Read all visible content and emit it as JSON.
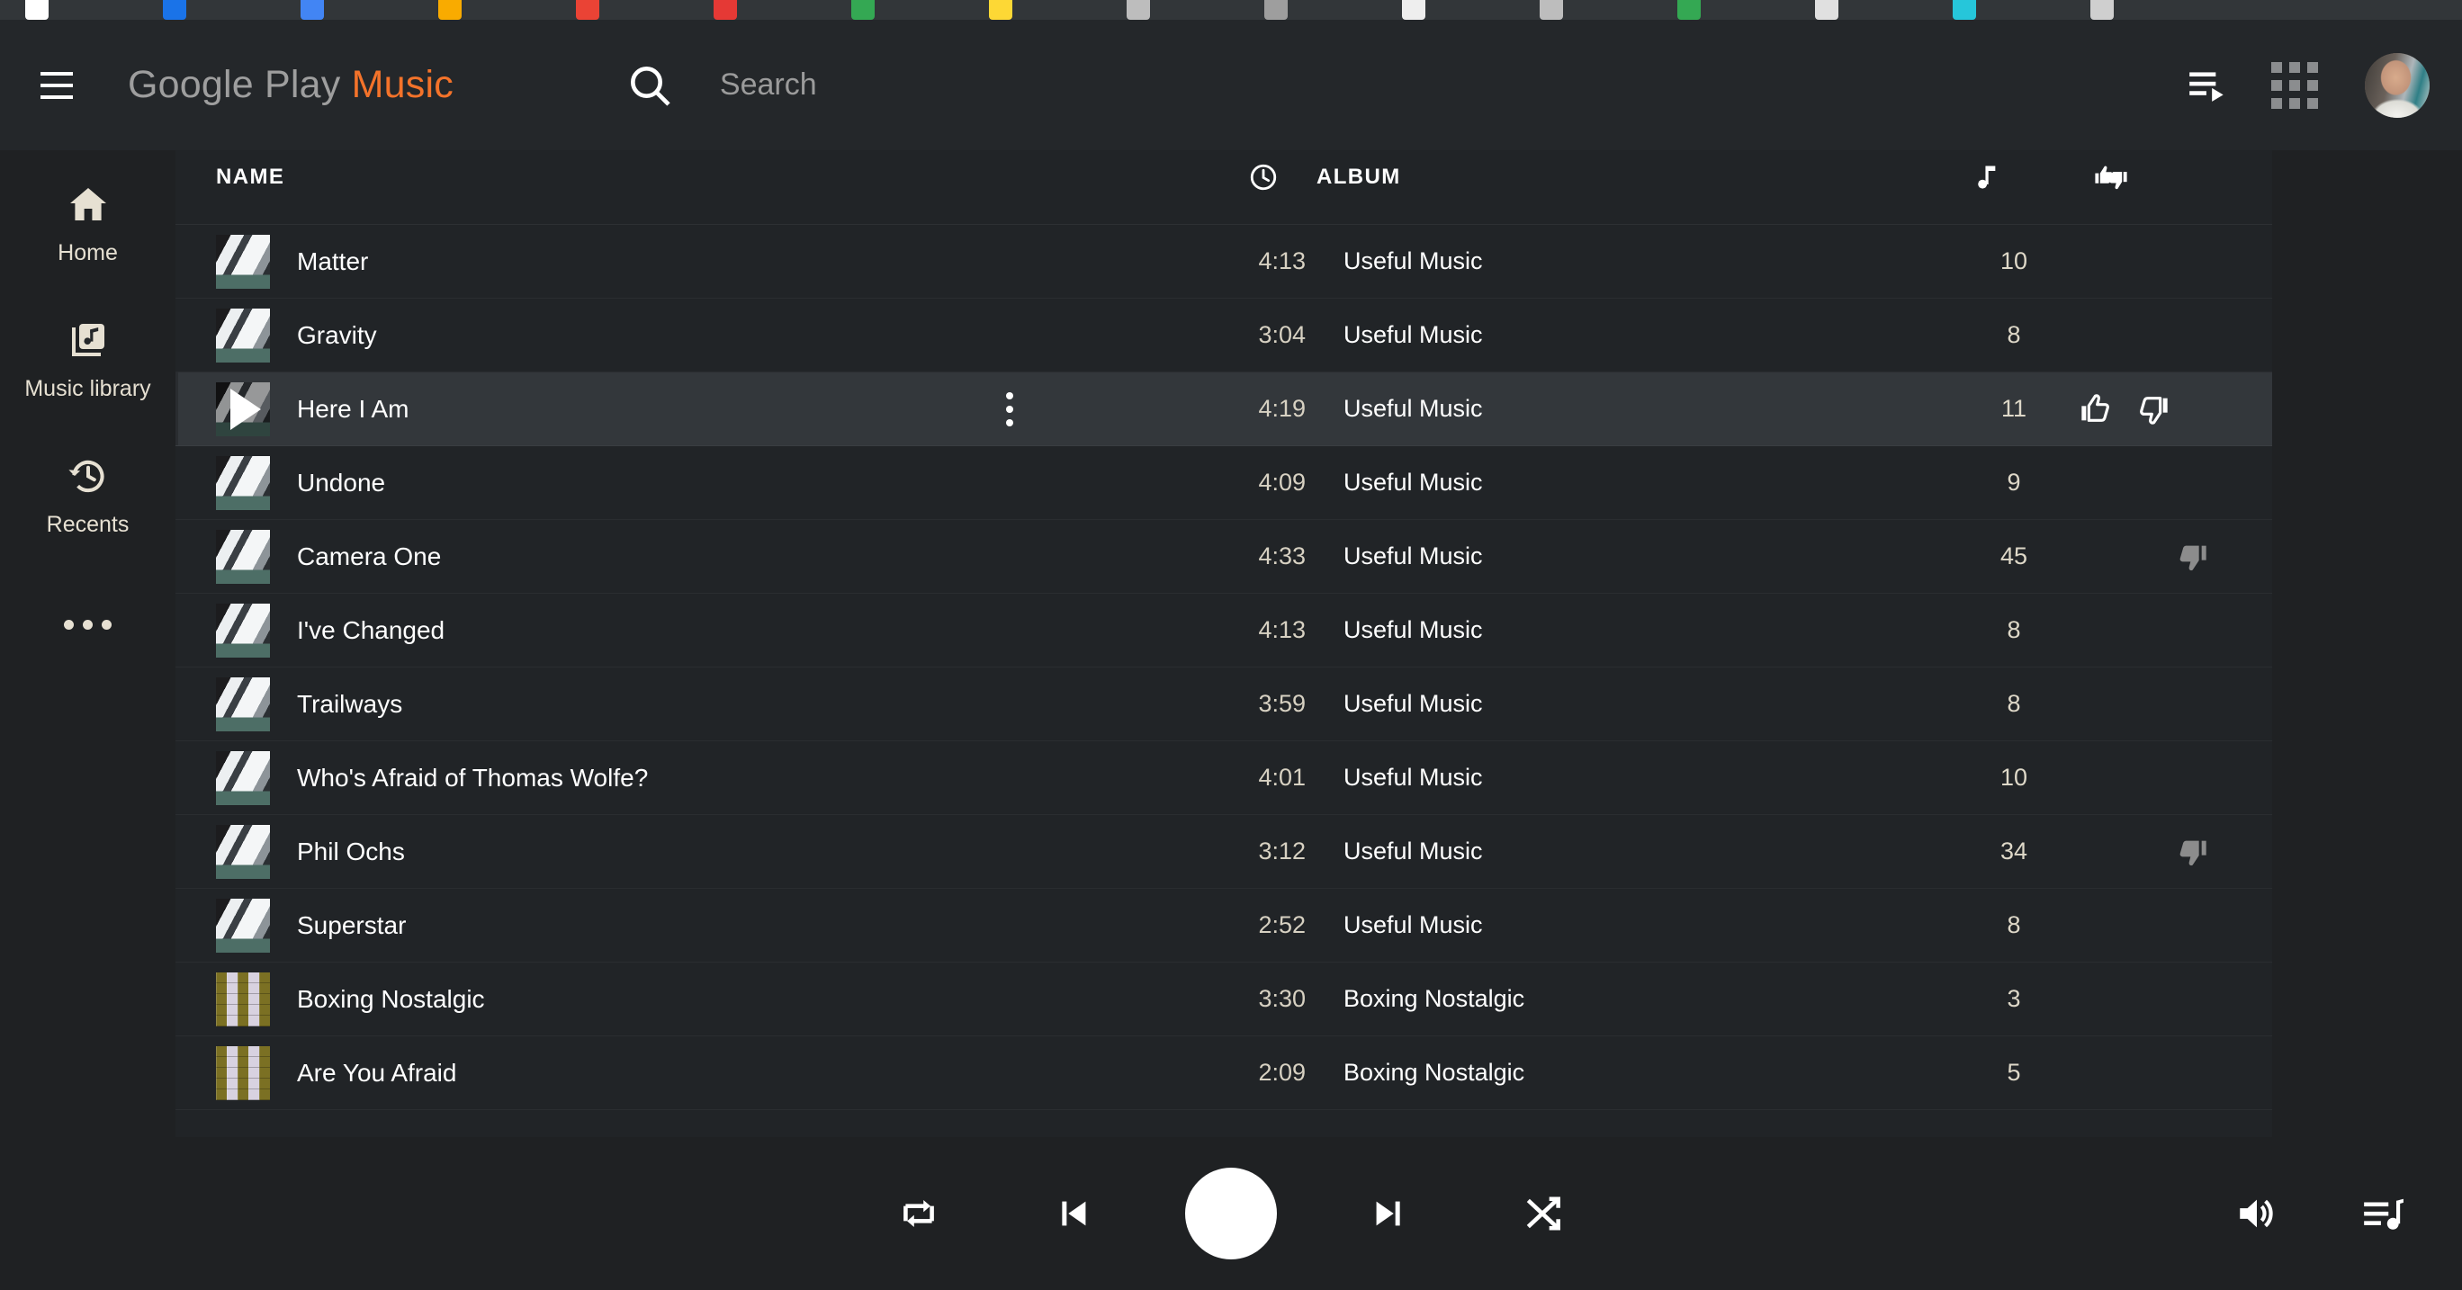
{
  "browser": {
    "favicon_colors": [
      "#ffffff",
      "#1a73e8",
      "#4285f4",
      "#f9ab00",
      "#ea4335",
      "#e53935",
      "#34a853",
      "#fdd835",
      "#bdbdbd",
      "#9e9e9e",
      "#eeeeee",
      "#bdbdbd",
      "#34a853",
      "#e0e0e0",
      "#26c6da",
      "#cfcfcf"
    ]
  },
  "header": {
    "menu_icon": "hamburger-menu-icon",
    "brand_part1": "Google Play",
    "brand_part2": "Music",
    "brand_accent_color": "#f4732a",
    "search": {
      "icon": "search-icon",
      "placeholder": "Search",
      "value": ""
    },
    "queue_icon": "playlist-play-icon",
    "apps_icon": "apps-grid-icon",
    "avatar_name": "user-avatar"
  },
  "sidebar": {
    "items": [
      {
        "label": "Home",
        "icon": "home-icon"
      },
      {
        "label": "Music library",
        "icon": "music-library-icon"
      },
      {
        "label": "Recents",
        "icon": "history-clock-icon"
      }
    ],
    "overflow_icon": "more-horizontal-icon"
  },
  "table": {
    "columns": {
      "name": "NAME",
      "duration_icon": "clock-icon",
      "album": "ALBUM",
      "plays_icon": "music-note-icon",
      "rating_icon": "thumbs-pair-icon"
    },
    "rows": [
      {
        "title": "Matter",
        "duration": "4:13",
        "album": "Useful Music",
        "plays": "10",
        "art": "useful",
        "rating": "none",
        "hovered": false
      },
      {
        "title": "Gravity",
        "duration": "3:04",
        "album": "Useful Music",
        "plays": "8",
        "art": "useful",
        "rating": "none",
        "hovered": false
      },
      {
        "title": "Here I Am",
        "duration": "4:19",
        "album": "Useful Music",
        "plays": "11",
        "art": "useful",
        "rating": "none",
        "hovered": true
      },
      {
        "title": "Undone",
        "duration": "4:09",
        "album": "Useful Music",
        "plays": "9",
        "art": "useful",
        "rating": "none",
        "hovered": false
      },
      {
        "title": "Camera One",
        "duration": "4:33",
        "album": "Useful Music",
        "plays": "45",
        "art": "useful",
        "rating": "down",
        "hovered": false
      },
      {
        "title": "I've Changed",
        "duration": "4:13",
        "album": "Useful Music",
        "plays": "8",
        "art": "useful",
        "rating": "none",
        "hovered": false
      },
      {
        "title": "Trailways",
        "duration": "3:59",
        "album": "Useful Music",
        "plays": "8",
        "art": "useful",
        "rating": "none",
        "hovered": false
      },
      {
        "title": "Who's Afraid of Thomas Wolfe?",
        "duration": "4:01",
        "album": "Useful Music",
        "plays": "10",
        "art": "useful",
        "rating": "none",
        "hovered": false
      },
      {
        "title": "Phil Ochs",
        "duration": "3:12",
        "album": "Useful Music",
        "plays": "34",
        "art": "useful",
        "rating": "down",
        "hovered": false
      },
      {
        "title": "Superstar",
        "duration": "2:52",
        "album": "Useful Music",
        "plays": "8",
        "art": "useful",
        "rating": "none",
        "hovered": false
      },
      {
        "title": "Boxing Nostalgic",
        "duration": "3:30",
        "album": "Boxing Nostalgic",
        "plays": "3",
        "art": "boxing",
        "rating": "none",
        "hovered": false
      },
      {
        "title": "Are You Afraid",
        "duration": "2:09",
        "album": "Boxing Nostalgic",
        "plays": "5",
        "art": "boxing",
        "rating": "none",
        "hovered": false
      }
    ]
  },
  "player": {
    "repeat_icon": "repeat-icon",
    "previous_icon": "skip-previous-icon",
    "play_icon": "play-pause-button",
    "next_icon": "skip-next-icon",
    "shuffle_icon": "shuffle-icon",
    "volume_icon": "volume-up-icon",
    "queue_icon": "queue-music-icon"
  },
  "colors": {
    "page_bg": "#1f2123",
    "header_bg": "#24272a",
    "list_bg": "#212427",
    "row_hover_bg": "#33373b",
    "accent_orange": "#f4732a",
    "duration_text": "#d7d1c2",
    "sidebar_text": "#e6e0d2"
  }
}
